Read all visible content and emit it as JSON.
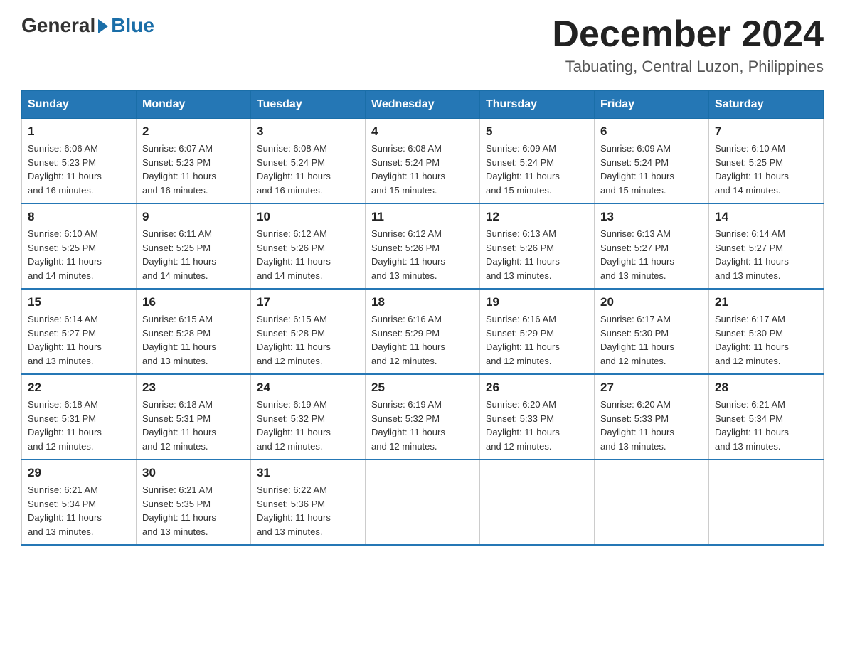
{
  "logo": {
    "general": "General",
    "blue": "Blue"
  },
  "title": "December 2024",
  "subtitle": "Tabuating, Central Luzon, Philippines",
  "days_of_week": [
    "Sunday",
    "Monday",
    "Tuesday",
    "Wednesday",
    "Thursday",
    "Friday",
    "Saturday"
  ],
  "weeks": [
    [
      {
        "day": "1",
        "sunrise": "6:06 AM",
        "sunset": "5:23 PM",
        "daylight": "11 hours and 16 minutes."
      },
      {
        "day": "2",
        "sunrise": "6:07 AM",
        "sunset": "5:23 PM",
        "daylight": "11 hours and 16 minutes."
      },
      {
        "day": "3",
        "sunrise": "6:08 AM",
        "sunset": "5:24 PM",
        "daylight": "11 hours and 16 minutes."
      },
      {
        "day": "4",
        "sunrise": "6:08 AM",
        "sunset": "5:24 PM",
        "daylight": "11 hours and 15 minutes."
      },
      {
        "day": "5",
        "sunrise": "6:09 AM",
        "sunset": "5:24 PM",
        "daylight": "11 hours and 15 minutes."
      },
      {
        "day": "6",
        "sunrise": "6:09 AM",
        "sunset": "5:24 PM",
        "daylight": "11 hours and 15 minutes."
      },
      {
        "day": "7",
        "sunrise": "6:10 AM",
        "sunset": "5:25 PM",
        "daylight": "11 hours and 14 minutes."
      }
    ],
    [
      {
        "day": "8",
        "sunrise": "6:10 AM",
        "sunset": "5:25 PM",
        "daylight": "11 hours and 14 minutes."
      },
      {
        "day": "9",
        "sunrise": "6:11 AM",
        "sunset": "5:25 PM",
        "daylight": "11 hours and 14 minutes."
      },
      {
        "day": "10",
        "sunrise": "6:12 AM",
        "sunset": "5:26 PM",
        "daylight": "11 hours and 14 minutes."
      },
      {
        "day": "11",
        "sunrise": "6:12 AM",
        "sunset": "5:26 PM",
        "daylight": "11 hours and 13 minutes."
      },
      {
        "day": "12",
        "sunrise": "6:13 AM",
        "sunset": "5:26 PM",
        "daylight": "11 hours and 13 minutes."
      },
      {
        "day": "13",
        "sunrise": "6:13 AM",
        "sunset": "5:27 PM",
        "daylight": "11 hours and 13 minutes."
      },
      {
        "day": "14",
        "sunrise": "6:14 AM",
        "sunset": "5:27 PM",
        "daylight": "11 hours and 13 minutes."
      }
    ],
    [
      {
        "day": "15",
        "sunrise": "6:14 AM",
        "sunset": "5:27 PM",
        "daylight": "11 hours and 13 minutes."
      },
      {
        "day": "16",
        "sunrise": "6:15 AM",
        "sunset": "5:28 PM",
        "daylight": "11 hours and 13 minutes."
      },
      {
        "day": "17",
        "sunrise": "6:15 AM",
        "sunset": "5:28 PM",
        "daylight": "11 hours and 12 minutes."
      },
      {
        "day": "18",
        "sunrise": "6:16 AM",
        "sunset": "5:29 PM",
        "daylight": "11 hours and 12 minutes."
      },
      {
        "day": "19",
        "sunrise": "6:16 AM",
        "sunset": "5:29 PM",
        "daylight": "11 hours and 12 minutes."
      },
      {
        "day": "20",
        "sunrise": "6:17 AM",
        "sunset": "5:30 PM",
        "daylight": "11 hours and 12 minutes."
      },
      {
        "day": "21",
        "sunrise": "6:17 AM",
        "sunset": "5:30 PM",
        "daylight": "11 hours and 12 minutes."
      }
    ],
    [
      {
        "day": "22",
        "sunrise": "6:18 AM",
        "sunset": "5:31 PM",
        "daylight": "11 hours and 12 minutes."
      },
      {
        "day": "23",
        "sunrise": "6:18 AM",
        "sunset": "5:31 PM",
        "daylight": "11 hours and 12 minutes."
      },
      {
        "day": "24",
        "sunrise": "6:19 AM",
        "sunset": "5:32 PM",
        "daylight": "11 hours and 12 minutes."
      },
      {
        "day": "25",
        "sunrise": "6:19 AM",
        "sunset": "5:32 PM",
        "daylight": "11 hours and 12 minutes."
      },
      {
        "day": "26",
        "sunrise": "6:20 AM",
        "sunset": "5:33 PM",
        "daylight": "11 hours and 12 minutes."
      },
      {
        "day": "27",
        "sunrise": "6:20 AM",
        "sunset": "5:33 PM",
        "daylight": "11 hours and 13 minutes."
      },
      {
        "day": "28",
        "sunrise": "6:21 AM",
        "sunset": "5:34 PM",
        "daylight": "11 hours and 13 minutes."
      }
    ],
    [
      {
        "day": "29",
        "sunrise": "6:21 AM",
        "sunset": "5:34 PM",
        "daylight": "11 hours and 13 minutes."
      },
      {
        "day": "30",
        "sunrise": "6:21 AM",
        "sunset": "5:35 PM",
        "daylight": "11 hours and 13 minutes."
      },
      {
        "day": "31",
        "sunrise": "6:22 AM",
        "sunset": "5:36 PM",
        "daylight": "11 hours and 13 minutes."
      },
      null,
      null,
      null,
      null
    ]
  ]
}
